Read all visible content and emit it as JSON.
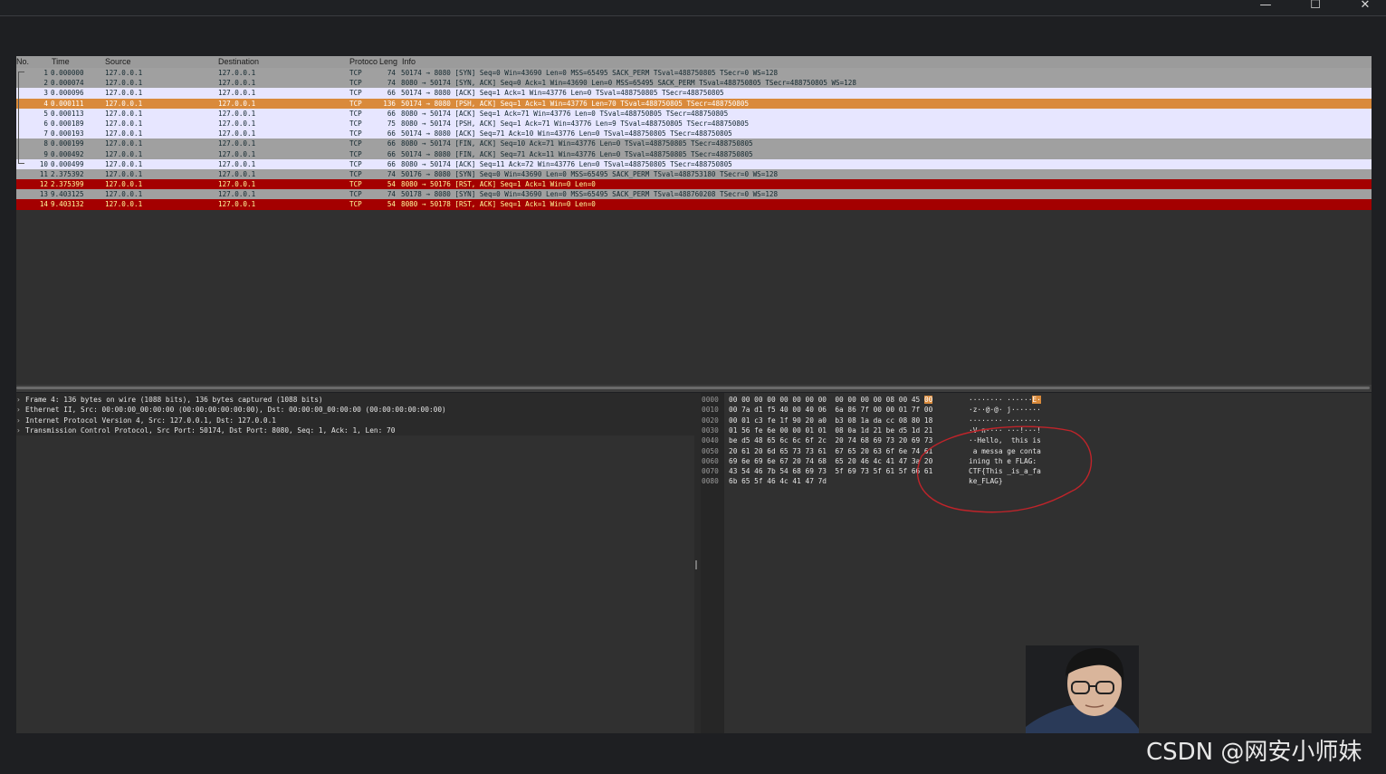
{
  "window": {
    "minimize_glyph": "—",
    "maximize_glyph": "☐",
    "close_glyph": "✕"
  },
  "packet_list": {
    "columns": {
      "no": "No.",
      "time": "Time",
      "source": "Source",
      "destination": "Destination",
      "protocol": "Protoco",
      "length": "Leng",
      "info": "Info"
    },
    "rows": [
      {
        "no": "1",
        "time": "0.000000",
        "src": "127.0.0.1",
        "dst": "127.0.0.1",
        "proto": "TCP",
        "len": "74",
        "info": "50174 → 8080 [SYN] Seq=0 Win=43690 Len=0 MSS=65495 SACK_PERM TSval=488750805 TSecr=0 WS=128",
        "style": "gray"
      },
      {
        "no": "2",
        "time": "0.000074",
        "src": "127.0.0.1",
        "dst": "127.0.0.1",
        "proto": "TCP",
        "len": "74",
        "info": "8080 → 50174 [SYN, ACK] Seq=0 Ack=1 Win=43690 Len=0 MSS=65495 SACK_PERM TSval=488750805 TSecr=488750805 WS=128",
        "style": "gray"
      },
      {
        "no": "3",
        "time": "0.000096",
        "src": "127.0.0.1",
        "dst": "127.0.0.1",
        "proto": "TCP",
        "len": "66",
        "info": "50174 → 8080 [ACK] Seq=1 Ack=1 Win=43776 Len=0 TSval=488750805 TSecr=488750805",
        "style": "purple"
      },
      {
        "no": "4",
        "time": "0.000111",
        "src": "127.0.0.1",
        "dst": "127.0.0.1",
        "proto": "TCP",
        "len": "136",
        "info": "50174 → 8080 [PSH, ACK] Seq=1 Ack=1 Win=43776 Len=70 TSval=488750805 TSecr=488750805",
        "style": "orange"
      },
      {
        "no": "5",
        "time": "0.000113",
        "src": "127.0.0.1",
        "dst": "127.0.0.1",
        "proto": "TCP",
        "len": "66",
        "info": "8080 → 50174 [ACK] Seq=1 Ack=71 Win=43776 Len=0 TSval=488750805 TSecr=488750805",
        "style": "purple"
      },
      {
        "no": "6",
        "time": "0.000189",
        "src": "127.0.0.1",
        "dst": "127.0.0.1",
        "proto": "TCP",
        "len": "75",
        "info": "8080 → 50174 [PSH, ACK] Seq=1 Ack=71 Win=43776 Len=9 TSval=488750805 TSecr=488750805",
        "style": "purple"
      },
      {
        "no": "7",
        "time": "0.000193",
        "src": "127.0.0.1",
        "dst": "127.0.0.1",
        "proto": "TCP",
        "len": "66",
        "info": "50174 → 8080 [ACK] Seq=71 Ack=10 Win=43776 Len=0 TSval=488750805 TSecr=488750805",
        "style": "purple"
      },
      {
        "no": "8",
        "time": "0.000199",
        "src": "127.0.0.1",
        "dst": "127.0.0.1",
        "proto": "TCP",
        "len": "66",
        "info": "8080 → 50174 [FIN, ACK] Seq=10 Ack=71 Win=43776 Len=0 TSval=488750805 TSecr=488750805",
        "style": "gray"
      },
      {
        "no": "9",
        "time": "0.000492",
        "src": "127.0.0.1",
        "dst": "127.0.0.1",
        "proto": "TCP",
        "len": "66",
        "info": "50174 → 8080 [FIN, ACK] Seq=71 Ack=11 Win=43776 Len=0 TSval=488750805 TSecr=488750805",
        "style": "gray"
      },
      {
        "no": "10",
        "time": "0.000499",
        "src": "127.0.0.1",
        "dst": "127.0.0.1",
        "proto": "TCP",
        "len": "66",
        "info": "8080 → 50174 [ACK] Seq=11 Ack=72 Win=43776 Len=0 TSval=488750805 TSecr=488750805",
        "style": "purple"
      },
      {
        "no": "11",
        "time": "2.375392",
        "src": "127.0.0.1",
        "dst": "127.0.0.1",
        "proto": "TCP",
        "len": "74",
        "info": "50176 → 8080 [SYN] Seq=0 Win=43690 Len=0 MSS=65495 SACK_PERM TSval=488753180 TSecr=0 WS=128",
        "style": "gray"
      },
      {
        "no": "12",
        "time": "2.375399",
        "src": "127.0.0.1",
        "dst": "127.0.0.1",
        "proto": "TCP",
        "len": "54",
        "info": "8080 → 50176 [RST, ACK] Seq=1 Ack=1 Win=0 Len=0",
        "style": "red"
      },
      {
        "no": "13",
        "time": "9.403125",
        "src": "127.0.0.1",
        "dst": "127.0.0.1",
        "proto": "TCP",
        "len": "74",
        "info": "50178 → 8080 [SYN] Seq=0 Win=43690 Len=0 MSS=65495 SACK_PERM TSval=488760208 TSecr=0 WS=128",
        "style": "gray"
      },
      {
        "no": "14",
        "time": "9.403132",
        "src": "127.0.0.1",
        "dst": "127.0.0.1",
        "proto": "TCP",
        "len": "54",
        "info": "8080 → 50178 [RST, ACK] Seq=1 Ack=1 Win=0 Len=0",
        "style": "red"
      }
    ]
  },
  "details": {
    "rows": [
      "Frame 4: 136 bytes on wire (1088 bits), 136 bytes captured (1088 bits)",
      "Ethernet II, Src: 00:00:00_00:00:00 (00:00:00:00:00:00), Dst: 00:00:00_00:00:00 (00:00:00:00:00:00)",
      "Internet Protocol Version 4, Src: 127.0.0.1, Dst: 127.0.0.1",
      "Transmission Control Protocol, Src Port: 50174, Dst Port: 8080, Seq: 1, Ack: 1, Len: 70"
    ]
  },
  "bytes": {
    "rows": [
      {
        "offset": "0000",
        "hex": "00 00 00 00 00 00 00 00  00 00 00 00 08 00 45 ",
        "hex_hl": "00",
        "ascii": "········ ······",
        "ascii_hl": "E·"
      },
      {
        "offset": "0010",
        "hex": "00 7a d1 f5 40 00 40 06  6a 86 7f 00 00 01 7f 00",
        "hex_hl": "",
        "ascii": "·z··@·@· j·······",
        "ascii_hl": ""
      },
      {
        "offset": "0020",
        "hex": "00 01 c3 fe 1f 90 20 a0  b3 08 1a da cc 08 80 18",
        "hex_hl": "",
        "ascii": "········ ········",
        "ascii_hl": ""
      },
      {
        "offset": "0030",
        "hex": "01 56 fe 6e 00 00 01 01  08 0a 1d 21 be d5 1d 21",
        "hex_hl": "",
        "ascii": "·V·n···· ···!···!",
        "ascii_hl": ""
      },
      {
        "offset": "0040",
        "hex": "be d5 48 65 6c 6c 6f 2c  20 74 68 69 73 20 69 73",
        "hex_hl": "",
        "ascii": "··Hello,  this is",
        "ascii_hl": ""
      },
      {
        "offset": "0050",
        "hex": "20 61 20 6d 65 73 73 61  67 65 20 63 6f 6e 74 61",
        "hex_hl": "",
        "ascii": " a messa ge conta",
        "ascii_hl": ""
      },
      {
        "offset": "0060",
        "hex": "69 6e 69 6e 67 20 74 68  65 20 46 4c 41 47 3a 20",
        "hex_hl": "",
        "ascii": "ining th e FLAG: ",
        "ascii_hl": ""
      },
      {
        "offset": "0070",
        "hex": "43 54 46 7b 54 68 69 73  5f 69 73 5f 61 5f 66 61",
        "hex_hl": "",
        "ascii": "CTF{This _is_a_fa",
        "ascii_hl": ""
      },
      {
        "offset": "0080",
        "hex": "6b 65 5f 46 4c 41 47 7d",
        "hex_hl": "",
        "ascii": "ke_FLAG}",
        "ascii_hl": ""
      }
    ]
  },
  "annotation_color": "#c0242a",
  "watermark": "CSDN @网安小师妹"
}
